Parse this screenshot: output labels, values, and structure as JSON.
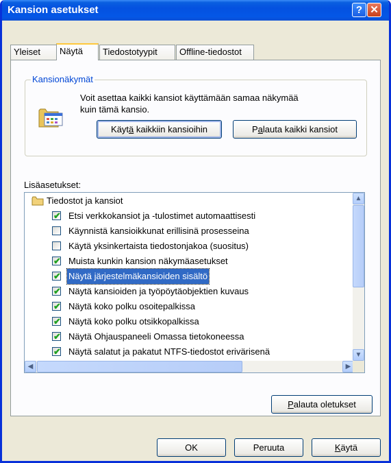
{
  "window": {
    "title": "Kansion asetukset"
  },
  "titlebar": {
    "help_label": "?",
    "close_label": "✕"
  },
  "tabs": [
    {
      "label": "Yleiset",
      "active": false
    },
    {
      "label": "Näytä",
      "active": true
    },
    {
      "label": "Tiedostotyypit",
      "active": false
    },
    {
      "label": "Offline-tiedostot",
      "active": false
    }
  ],
  "folder_views": {
    "group_label": "Kansionäkymät",
    "description_line1": "Voit asettaa kaikki kansiot käyttämään samaa näkymää",
    "description_line2": "kuin tämä kansio.",
    "apply_all_button": {
      "pre": "Käyt",
      "key": "ä",
      "post": " kaikkiin kansioihin"
    },
    "reset_all_button": {
      "pre": "P",
      "key": "a",
      "post": "lauta kaikki kansiot"
    }
  },
  "advanced": {
    "label": "Lisäasetukset:",
    "root": "Tiedostot ja kansiot",
    "items": [
      {
        "label": "Etsi verkkokansiot ja -tulostimet automaattisesti",
        "checked": true,
        "selected": false
      },
      {
        "label": "Käynnistä kansioikkunat erillisinä prosesseina",
        "checked": false,
        "selected": false
      },
      {
        "label": "Käytä yksinkertaista tiedostonjakoa (suositus)",
        "checked": false,
        "selected": false
      },
      {
        "label": "Muista kunkin kansion näkymäasetukset",
        "checked": true,
        "selected": false
      },
      {
        "label": "Näytä järjestelmäkansioiden sisältö",
        "checked": true,
        "selected": true
      },
      {
        "label": "Näytä kansioiden ja työpöytäobjektien kuvaus",
        "checked": true,
        "selected": false
      },
      {
        "label": "Näytä koko polku osoitepalkissa",
        "checked": true,
        "selected": false
      },
      {
        "label": "Näytä koko polku otsikkopalkissa",
        "checked": true,
        "selected": false
      },
      {
        "label": "Näytä Ohjauspaneeli Omassa tietokoneessa",
        "checked": true,
        "selected": false
      },
      {
        "label": "Näytä salatut ja pakatut NTFS-tiedostot erivärisenä",
        "checked": true,
        "selected": false
      }
    ],
    "restore_defaults_button": {
      "pre": "",
      "key": "P",
      "post": "alauta oletukset"
    }
  },
  "dialog_buttons": {
    "ok": "OK",
    "cancel": "Peruuta",
    "apply": {
      "pre": "",
      "key": "K",
      "post": "äytä"
    }
  },
  "colors": {
    "titlebar": "#0451e0",
    "selection": "#316ac5",
    "tab_highlight": "#ffc83c",
    "checkmark": "#21a121"
  }
}
